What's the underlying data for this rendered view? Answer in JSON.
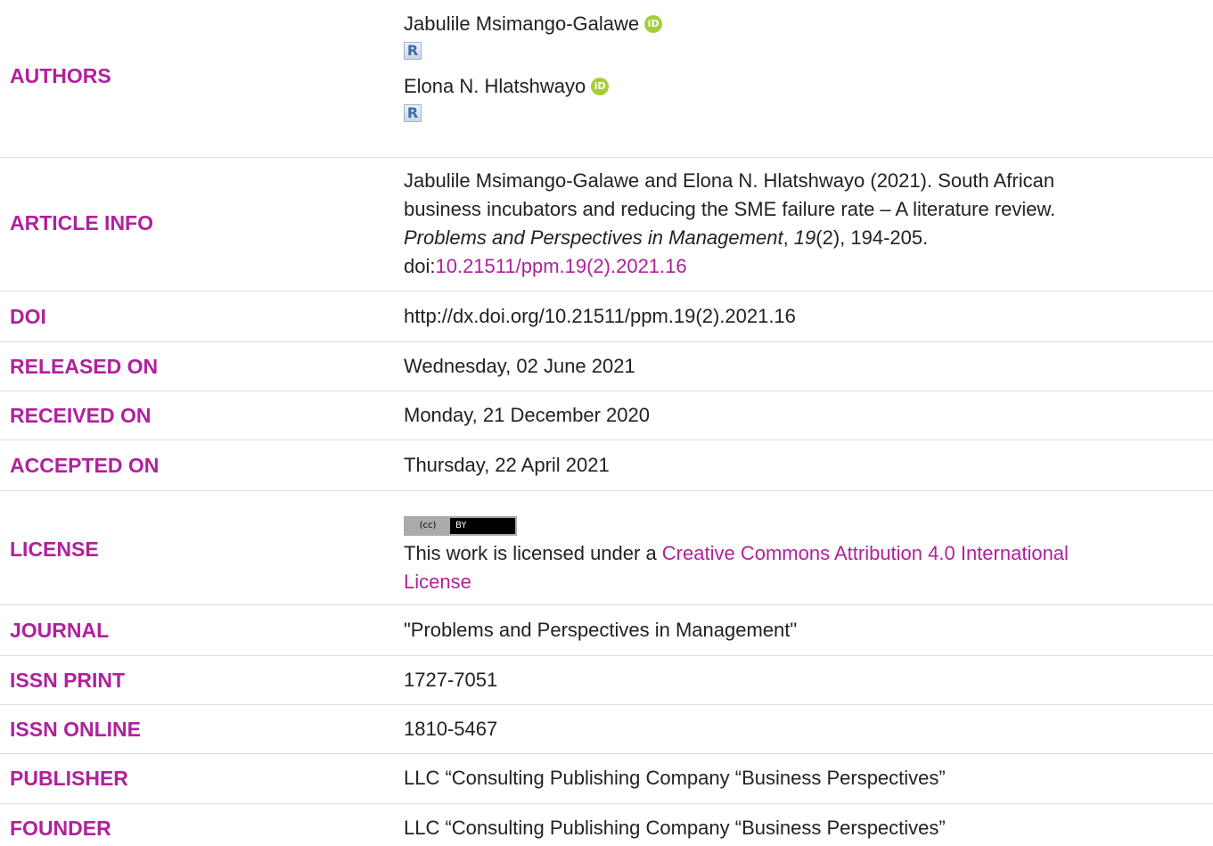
{
  "authors": {
    "label": "AUTHORS",
    "items": [
      {
        "name": "Jabulile Msimango-Galawe",
        "orcid_icon": "iD",
        "rg_icon": "R"
      },
      {
        "name": "Elona N. Hlatshwayo",
        "orcid_icon": "iD",
        "rg_icon": "R"
      }
    ]
  },
  "article_info": {
    "label": "ARTICLE INFO",
    "citation_line1": "Jabulile Msimango-Galawe and Elona N. Hlatshwayo (2021). South African",
    "citation_line2": "business incubators and reducing the SME failure rate – A literature review.",
    "journal_italic": "Problems and Perspectives in Management",
    "sep1": ", ",
    "volume_italic": "19",
    "issue_pages": "(2), 194-205.",
    "doi_prefix": "doi:",
    "doi_link": "10.21511/ppm.19(2).2021.16"
  },
  "doi": {
    "label": "DOI",
    "value": "http://dx.doi.org/10.21511/ppm.19(2).2021.16"
  },
  "released": {
    "label": "RELEASED ON",
    "value": "Wednesday, 02 June 2021"
  },
  "received": {
    "label": "RECEIVED ON",
    "value": "Monday, 21 December 2020"
  },
  "accepted": {
    "label": "ACCEPTED ON",
    "value": "Thursday, 22 April 2021"
  },
  "license": {
    "label": "LICENSE",
    "badge_left": "(cc)",
    "badge_right": "BY",
    "text_prefix": "This work is licensed under a ",
    "link_line1": "Creative Commons Attribution 4.0 International",
    "link_line2": "License"
  },
  "journal": {
    "label": "JOURNAL",
    "value": "\"Problems and Perspectives in Management\""
  },
  "issn_print": {
    "label": "ISSN PRINT",
    "value": "1727-7051"
  },
  "issn_online": {
    "label": "ISSN ONLINE",
    "value": "1810-5467"
  },
  "publisher": {
    "label": "PUBLISHER",
    "value": "LLC “Consulting Publishing Company “Business Perspectives”"
  },
  "founder": {
    "label": "FOUNDER",
    "value": "LLC “Consulting Publishing Company “Business Perspectives”"
  },
  "colors": {
    "label": "#b0219c",
    "link": "#b0219c",
    "orcid": "#a6ce39",
    "divider": "#dddddd"
  }
}
